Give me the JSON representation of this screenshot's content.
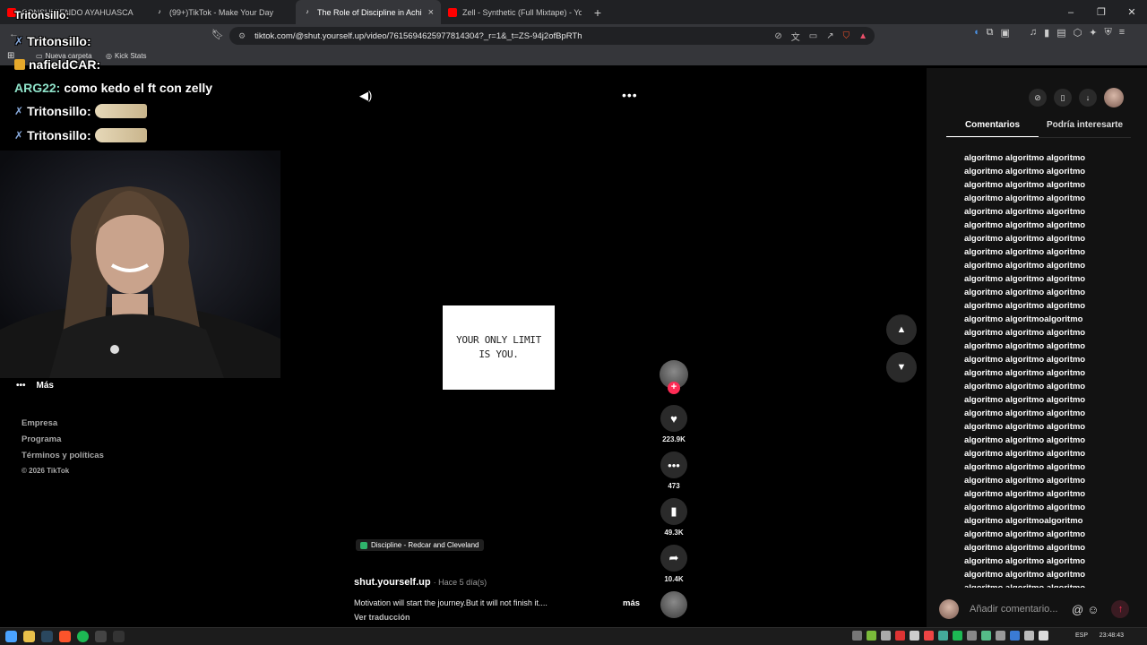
{
  "browser": {
    "tabs": [
      {
        "label": "CONSUMIENDO AYAHUASCA",
        "favicon_color": "#ff0000",
        "active": false
      },
      {
        "label": "(99+)TikTok - Make Your Day",
        "favicon_color": "#ffffff",
        "active": false
      },
      {
        "label": "The Role of Discipline in Achi",
        "favicon_color": "#ffffff",
        "active": true
      },
      {
        "label": "Zell - Synthetic (Full Mixtape) - YouTu",
        "favicon_color": "#ff0000",
        "active": false
      }
    ],
    "new_tab": "+",
    "url": "tiktok.com/@shut.yourself.up/video/7615694625977814304?_r=1&_t=ZS-94j2ofBpRTh",
    "bookmarks": [
      {
        "label": "Nueva carpeta"
      },
      {
        "label": "Kick Stats"
      }
    ]
  },
  "chat": {
    "lines": [
      {
        "user": "Tritonsillo:",
        "message": ""
      },
      {
        "user": "Tritonsillo:",
        "message": ""
      },
      {
        "user": "nafieldCAR:",
        "message": ""
      },
      {
        "user": "ARG22:",
        "message": "como kedo el ft con zelly"
      },
      {
        "user": "Tritonsillo:",
        "message": ""
      },
      {
        "user": "Tritonsillo:",
        "message": ""
      }
    ],
    "colors": {
      "tritonsillo": "#ffffff",
      "nafield": "#ffffff",
      "arg22": "#8ee1c8"
    }
  },
  "leftnav": {
    "more": "Más",
    "footer": [
      "Empresa",
      "Programa",
      "Términos y políticas"
    ],
    "copyright": "© 2026 TikTok"
  },
  "video": {
    "card_text": "YOUR ONLY LIMIT IS YOU.",
    "music": "Discipline - Redcar and Cleveland",
    "author": "shut.yourself.up",
    "posted": "· Hace 5 día(s)",
    "caption": "Motivation will start the journey.But it will not finish it....",
    "more": "más",
    "translate": "Ver traducción",
    "progress": 1.0
  },
  "actions": {
    "likes": "223.9K",
    "comments": "473",
    "saves": "49.3K",
    "shares": "10.4K"
  },
  "right_panel": {
    "tabs": [
      "Comentarios",
      "Podría interesarte"
    ],
    "comments": [
      "algoritmo algoritmo algoritmo",
      "algoritmo algoritmo algoritmo",
      "algoritmo algoritmo algoritmo",
      "algoritmo algoritmo algoritmo",
      "algoritmo algoritmo algoritmo",
      "algoritmo algoritmo algoritmo",
      "algoritmo algoritmo algoritmo",
      "algoritmo algoritmo algoritmo",
      "algoritmo algoritmo algoritmo",
      "algoritmo algoritmo algoritmo",
      "algoritmo algoritmo algoritmo",
      "algoritmo algoritmo algoritmo",
      "algoritmo algoritmoalgoritmo",
      "algoritmo algoritmo algoritmo",
      "algoritmo algoritmo algoritmo",
      "algoritmo algoritmo algoritmo",
      "algoritmo algoritmo algoritmo",
      "algoritmo algoritmo algoritmo",
      "algoritmo algoritmo algoritmo",
      "algoritmo algoritmo algoritmo",
      "algoritmo algoritmo algoritmo",
      "algoritmo algoritmo algoritmo",
      "algoritmo algoritmo algoritmo",
      "algoritmo algoritmo algoritmo",
      "algoritmo algoritmo algoritmo",
      "algoritmo algoritmo algoritmo",
      "algoritmo algoritmo algoritmo",
      "algoritmo algoritmoalgoritmo",
      "algoritmo algoritmo algoritmo",
      "algoritmo algoritmo algoritmo",
      "algoritmo algoritmo algoritmo",
      "algoritmo algoritmo algoritmo",
      "algoritmo algoritmo algoritmo"
    ],
    "comment_placeholder": "Añadir comentario...",
    "accent": "#fe2c55"
  },
  "taskbar": {
    "lang": "ESP",
    "time": "23:48:43"
  }
}
